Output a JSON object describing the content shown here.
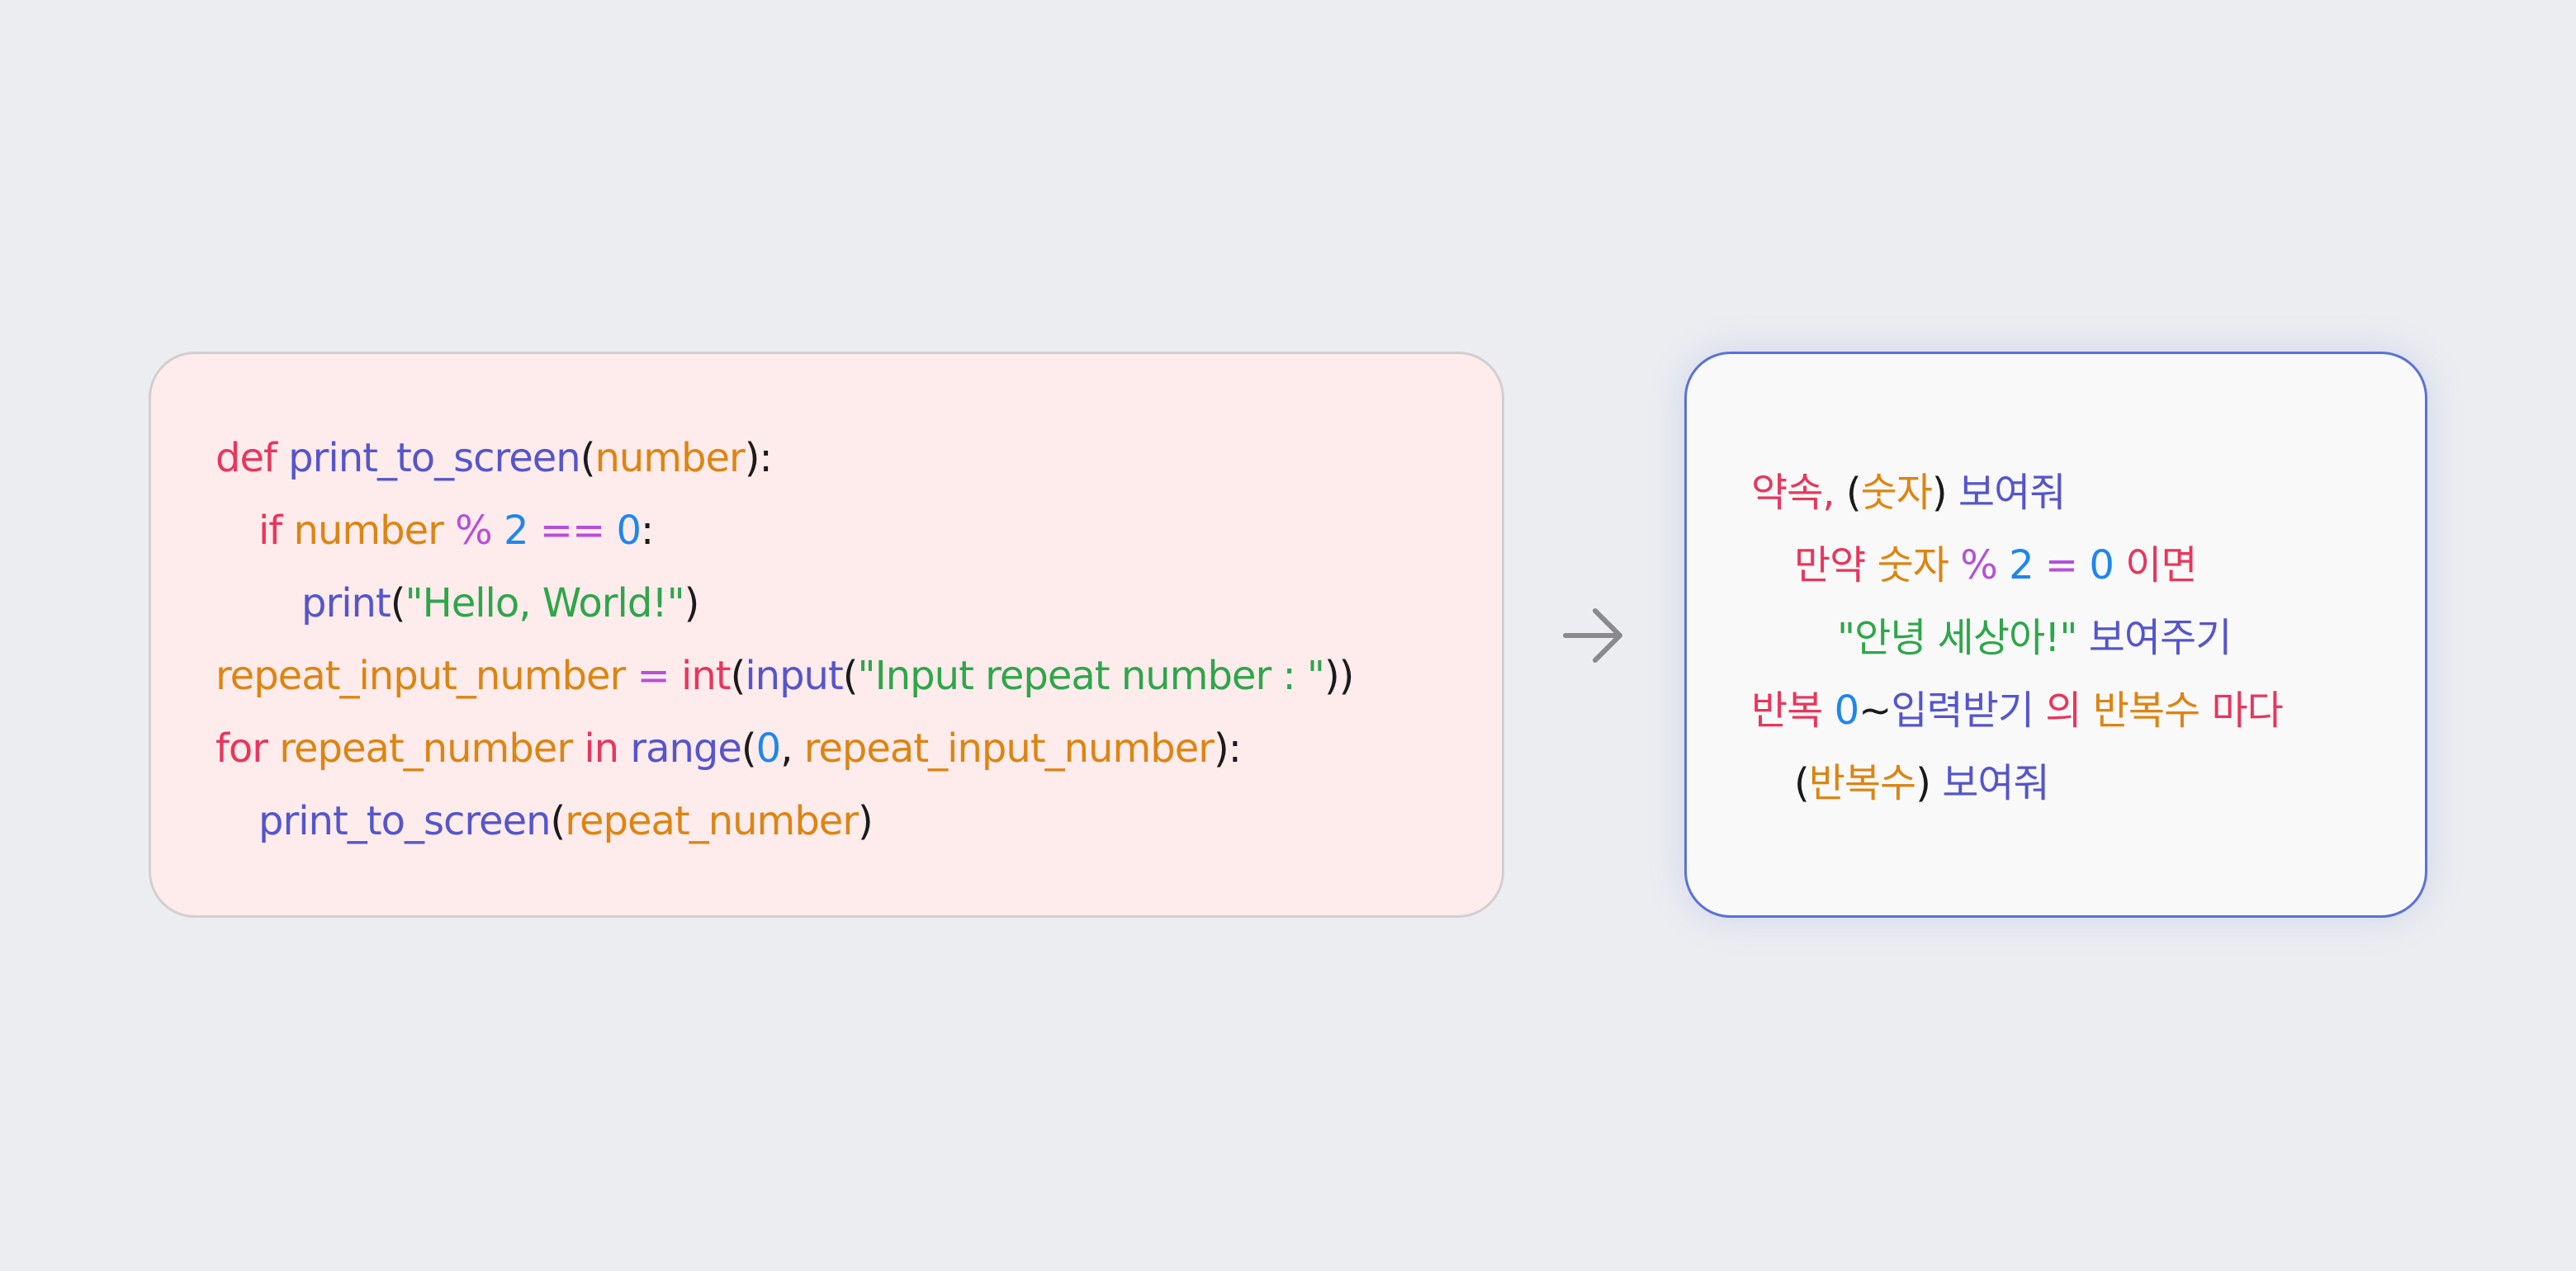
{
  "colors": {
    "background": "#ECEDF1",
    "keyword": "#E8365C",
    "function": "#5555CC",
    "variable": "#DC8512",
    "operator": "#B54FDB",
    "number": "#1E86EE",
    "string": "#2EA64A",
    "punctuation": "#1A1A1A",
    "arrow": "#8A8A8C",
    "code_panel_bg": "#FEEBEC",
    "korean_panel_border": "#5872D8"
  },
  "code": {
    "lines": [
      {
        "indent": 0,
        "tokens": [
          {
            "t": "def",
            "c": "keyword"
          },
          {
            "t": " ",
            "c": "punctuation"
          },
          {
            "t": "print_to_screen",
            "c": "function"
          },
          {
            "t": "(",
            "c": "punctuation"
          },
          {
            "t": "number",
            "c": "variable"
          },
          {
            "t": "):",
            "c": "punctuation"
          }
        ]
      },
      {
        "indent": 1,
        "tokens": [
          {
            "t": "if",
            "c": "keyword"
          },
          {
            "t": " ",
            "c": "punctuation"
          },
          {
            "t": "number",
            "c": "variable"
          },
          {
            "t": " ",
            "c": "punctuation"
          },
          {
            "t": "%",
            "c": "operator"
          },
          {
            "t": " ",
            "c": "punctuation"
          },
          {
            "t": "2",
            "c": "number"
          },
          {
            "t": " ",
            "c": "punctuation"
          },
          {
            "t": "==",
            "c": "operator"
          },
          {
            "t": " ",
            "c": "punctuation"
          },
          {
            "t": "0",
            "c": "number"
          },
          {
            "t": ":",
            "c": "punctuation"
          }
        ]
      },
      {
        "indent": 2,
        "tokens": [
          {
            "t": "print",
            "c": "function"
          },
          {
            "t": "(",
            "c": "punctuation"
          },
          {
            "t": "\"Hello, World!\"",
            "c": "string"
          },
          {
            "t": ")",
            "c": "punctuation"
          }
        ]
      },
      {
        "indent": 0,
        "tokens": [
          {
            "t": "repeat_input_number",
            "c": "variable"
          },
          {
            "t": " ",
            "c": "punctuation"
          },
          {
            "t": "=",
            "c": "operator"
          },
          {
            "t": " ",
            "c": "punctuation"
          },
          {
            "t": "int",
            "c": "keyword"
          },
          {
            "t": "(",
            "c": "punctuation"
          },
          {
            "t": "input",
            "c": "function"
          },
          {
            "t": "(",
            "c": "punctuation"
          },
          {
            "t": "\"Input repeat number : \"",
            "c": "string"
          },
          {
            "t": "))",
            "c": "punctuation"
          }
        ]
      },
      {
        "indent": 0,
        "tokens": [
          {
            "t": "for",
            "c": "keyword"
          },
          {
            "t": " ",
            "c": "punctuation"
          },
          {
            "t": "repeat_number",
            "c": "variable"
          },
          {
            "t": " ",
            "c": "punctuation"
          },
          {
            "t": "in",
            "c": "keyword"
          },
          {
            "t": " ",
            "c": "punctuation"
          },
          {
            "t": "range",
            "c": "function"
          },
          {
            "t": "(",
            "c": "punctuation"
          },
          {
            "t": "0",
            "c": "number"
          },
          {
            "t": ", ",
            "c": "punctuation"
          },
          {
            "t": "repeat_input_number",
            "c": "variable"
          },
          {
            "t": "):",
            "c": "punctuation"
          }
        ]
      },
      {
        "indent": 1,
        "tokens": [
          {
            "t": "print_to_screen",
            "c": "function"
          },
          {
            "t": "(",
            "c": "punctuation"
          },
          {
            "t": "repeat_number",
            "c": "variable"
          },
          {
            "t": ")",
            "c": "punctuation"
          }
        ]
      }
    ]
  },
  "korean": {
    "lines": [
      {
        "indent": 0,
        "tokens": [
          {
            "t": "약속,",
            "c": "keyword"
          },
          {
            "t": " ",
            "c": "punctuation"
          },
          {
            "t": "(",
            "c": "punctuation"
          },
          {
            "t": "숫자",
            "c": "variable"
          },
          {
            "t": ")",
            "c": "punctuation"
          },
          {
            "t": " ",
            "c": "punctuation"
          },
          {
            "t": "보여줘",
            "c": "function"
          }
        ]
      },
      {
        "indent": 1,
        "tokens": [
          {
            "t": "만약",
            "c": "keyword"
          },
          {
            "t": " ",
            "c": "punctuation"
          },
          {
            "t": "숫자",
            "c": "variable"
          },
          {
            "t": " ",
            "c": "punctuation"
          },
          {
            "t": "%",
            "c": "operator"
          },
          {
            "t": " ",
            "c": "punctuation"
          },
          {
            "t": "2",
            "c": "number"
          },
          {
            "t": " ",
            "c": "punctuation"
          },
          {
            "t": "=",
            "c": "operator"
          },
          {
            "t": " ",
            "c": "punctuation"
          },
          {
            "t": "0",
            "c": "number"
          },
          {
            "t": " ",
            "c": "punctuation"
          },
          {
            "t": "이면",
            "c": "keyword"
          }
        ]
      },
      {
        "indent": 2,
        "tokens": [
          {
            "t": "\"안녕 세상아!\"",
            "c": "string"
          },
          {
            "t": " ",
            "c": "punctuation"
          },
          {
            "t": "보여주기",
            "c": "function"
          }
        ]
      },
      {
        "indent": 0,
        "tokens": [
          {
            "t": "반복",
            "c": "keyword"
          },
          {
            "t": " ",
            "c": "punctuation"
          },
          {
            "t": "0",
            "c": "number"
          },
          {
            "t": "~",
            "c": "punctuation"
          },
          {
            "t": "입력받기",
            "c": "function"
          },
          {
            "t": " ",
            "c": "punctuation"
          },
          {
            "t": "의",
            "c": "keyword"
          },
          {
            "t": " ",
            "c": "punctuation"
          },
          {
            "t": "반복수",
            "c": "variable"
          },
          {
            "t": " ",
            "c": "punctuation"
          },
          {
            "t": "마다",
            "c": "keyword"
          }
        ]
      },
      {
        "indent": 1,
        "tokens": [
          {
            "t": "(",
            "c": "punctuation"
          },
          {
            "t": "반복수",
            "c": "variable"
          },
          {
            "t": ")",
            "c": "punctuation"
          },
          {
            "t": " ",
            "c": "punctuation"
          },
          {
            "t": "보여줘",
            "c": "function"
          }
        ]
      }
    ]
  }
}
